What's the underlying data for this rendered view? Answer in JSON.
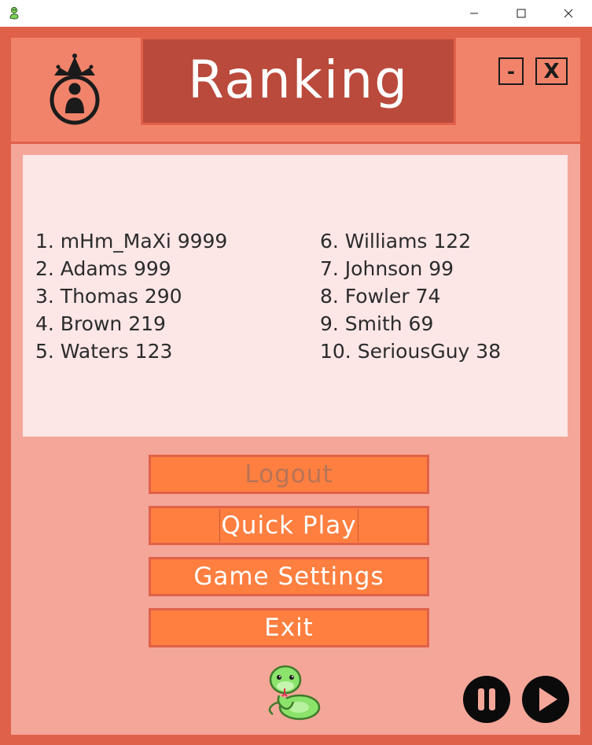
{
  "window": {
    "icon": "snake-icon",
    "controls": [
      "minimize-icon",
      "maximize-icon",
      "close-icon"
    ]
  },
  "header": {
    "title": "Ranking",
    "logo_icon": "king-crown-icon",
    "minimize_label": "-",
    "close_label": "X"
  },
  "ranking": {
    "left": [
      {
        "text": "1. mHm_MaXi 9999"
      },
      {
        "text": "2. Adams 999"
      },
      {
        "text": "3. Thomas 290"
      },
      {
        "text": "4. Brown 219"
      },
      {
        "text": "5. Waters 123"
      }
    ],
    "right": [
      {
        "text": "6. Williams 122"
      },
      {
        "text": "7. Johnson 99"
      },
      {
        "text": "8. Fowler 74"
      },
      {
        "text": "9. Smith 69"
      },
      {
        "text": "10. SeriousGuy 38"
      }
    ]
  },
  "menu": {
    "logout_label": "Logout",
    "quick_play_label": "Quick Play",
    "game_settings_label": "Game Settings",
    "exit_label": "Exit"
  },
  "footer": {
    "mascot_icon": "snake-mascot-icon",
    "pause_icon": "pause-icon",
    "play_icon": "play-icon"
  },
  "colors": {
    "frame": "#e0614a",
    "header": "#f1836b",
    "body": "#f4a698",
    "title_box": "#ba4a3c",
    "panel": "#fde6e6",
    "button": "#fe7f3f",
    "button_disabled_text": "#b87357"
  }
}
